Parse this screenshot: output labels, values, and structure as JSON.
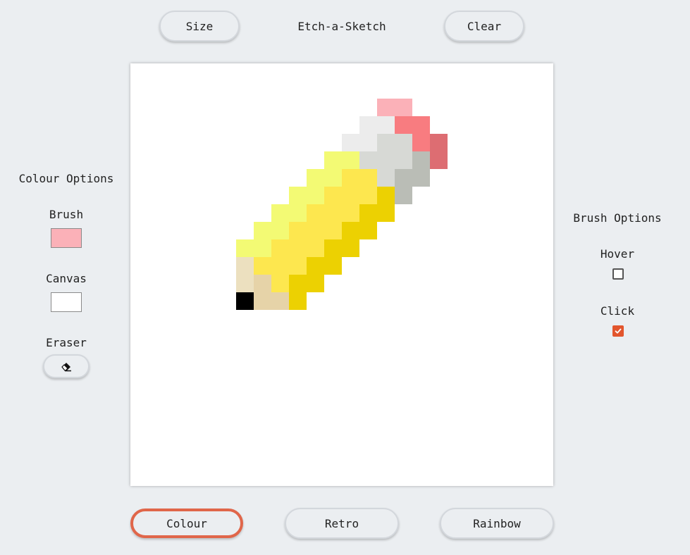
{
  "header": {
    "title": "Etch-a-Sketch",
    "size_label": "Size",
    "clear_label": "Clear"
  },
  "colour_options": {
    "heading": "Colour Options",
    "brush_label": "Brush",
    "brush_color": "#fbb1b8",
    "canvas_label": "Canvas",
    "canvas_color": "#ffffff",
    "eraser_label": "Eraser",
    "eraser_icon": "eraser-icon"
  },
  "brush_options": {
    "heading": "Brush Options",
    "hover_label": "Hover",
    "hover_checked": false,
    "click_label": "Click",
    "click_checked": true
  },
  "modes": {
    "colour_label": "Colour",
    "retro_label": "Retro",
    "rainbow_label": "Rainbow",
    "active": "Colour",
    "active_border_color": "#e0664a"
  },
  "accent_color": "#e2552d",
  "drawing": {
    "grid_cell_size": 25,
    "palette": {
      "P": "#fbb1b8",
      "R": "#f87c80",
      "D": "#dd6d72",
      "W": "#ececec",
      "G": "#d7d9d5",
      "S": "#babdb6",
      "L": "#f3fa74",
      "Y": "#fde74f",
      "O": "#ecd102",
      "T": "#ece0bf",
      "C": "#e6d3a8",
      "K": "#000000"
    },
    "rows": [
      "........................",
      "........................",
      "..............PP........",
      ".............WWRR.......",
      "............WWGGRD......",
      "...........LLGGGSD......",
      "..........LLYYGSS.......",
      ".........LLYYYOS........",
      "........LLYYYOO.........",
      ".......LLYYYOO..........",
      "......LLYYYOO...........",
      "......TYYYOO............",
      "......TCYOO.............",
      "......KCCO.............."
    ]
  }
}
